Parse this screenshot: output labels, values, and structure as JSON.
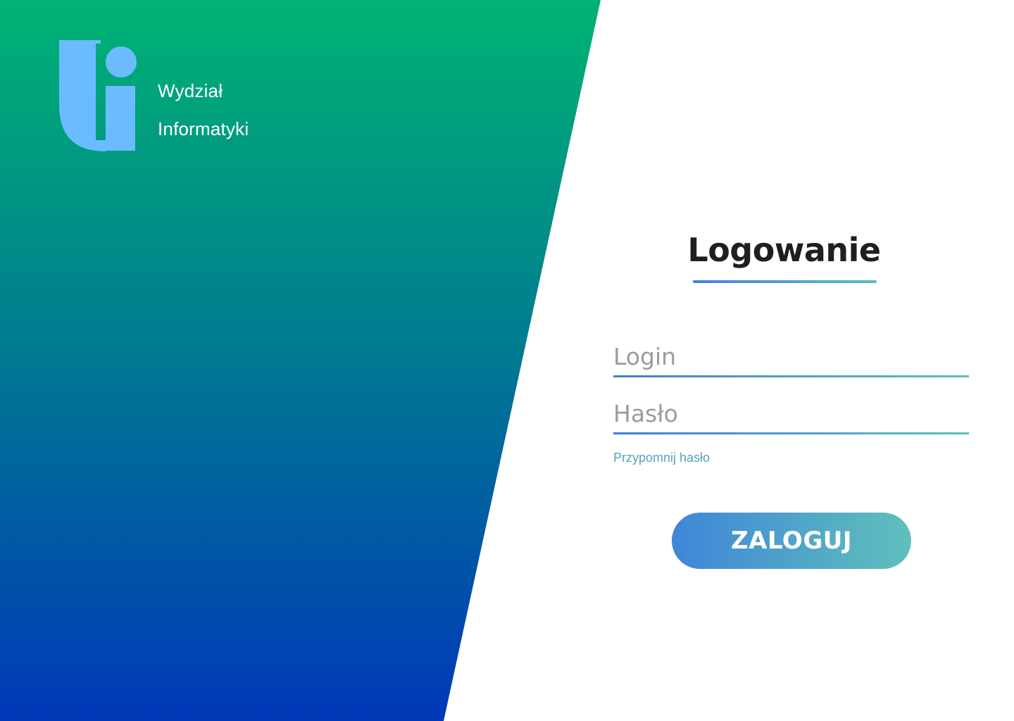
{
  "brand": {
    "logo_icon": "faculty-i-logo-icon",
    "line1": "Wydział",
    "line2": "Informatyki"
  },
  "login": {
    "title": "Logowanie",
    "login_placeholder": "Login",
    "login_value": "",
    "password_placeholder": "Hasło",
    "password_value": "",
    "forgot_password": "Przypomnij hasło",
    "submit_label": "ZALOGUJ"
  },
  "colors": {
    "gradient_top": "#00b373",
    "gradient_bottom": "#0038b8",
    "logo": "#6bbcff",
    "accent_start": "#3f86d8",
    "accent_end": "#5fc0bb",
    "link": "#55a5b4",
    "title": "#1f1f1f"
  }
}
